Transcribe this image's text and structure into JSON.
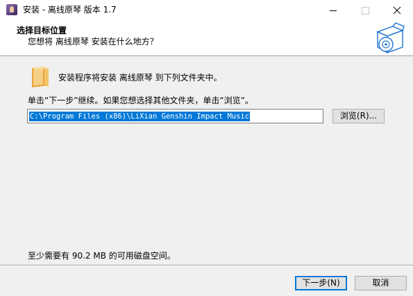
{
  "window": {
    "title": "安装 - 离线原琴 版本 1.7",
    "icon": "app-icon"
  },
  "titlebar_buttons": {
    "minimize_icon": "minimize-icon",
    "maximize_icon": "maximize-icon",
    "close_icon": "close-icon"
  },
  "header": {
    "title": "选择目标位置",
    "subtitle": "您想将 离线原琴 安装在什么地方？",
    "icon": "disc-box-icon"
  },
  "body": {
    "folder_icon": "folder-icon",
    "install_info": "安装程序将安装 离线原琴 到下列文件夹中。",
    "instruction": "单击“下一步”继续。如果您想选择其他文件夹，单击“浏览”。",
    "path_value": "C:\\Program Files (x86)\\LiXian Genshin Impact Music",
    "browse_label": "浏览(R)...",
    "space_required": "至少需要有 90.2 MB 的可用磁盘空间。"
  },
  "footer": {
    "next_label": "下一步(N)",
    "cancel_label": "取消"
  },
  "colors": {
    "accent": "#0078d7",
    "selection_bg": "#0078d7",
    "dialog_bg": "#f0f0f0"
  }
}
